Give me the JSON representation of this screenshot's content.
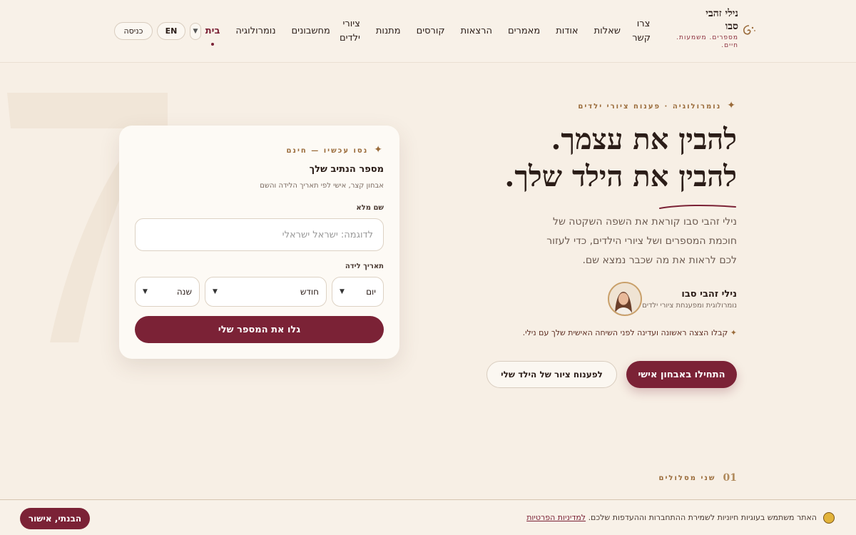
{
  "header": {
    "logo": {
      "title_line1": "נילי זהבי",
      "title_line2": "סבו",
      "tagline": "מספרים. משמעות. חיים."
    },
    "nav": [
      {
        "label": "בית",
        "active": true
      },
      {
        "label": "נומרולוגיה"
      },
      {
        "label": "מחשבונים"
      },
      {
        "label": "ציורי ילדים"
      },
      {
        "label": "מתנות"
      },
      {
        "label": "קורסים"
      },
      {
        "label": "הרצאות"
      },
      {
        "label": "מאמרים"
      },
      {
        "label": "אודות"
      },
      {
        "label": "שאלות"
      },
      {
        "label": "צרו קשר"
      }
    ],
    "lang_label": "EN",
    "login_label": "כניסה",
    "lang_dropdown_icon": "chevron-down-icon"
  },
  "hero": {
    "eyebrow": "נומרולוגיה · פענוח ציורי ילדים",
    "h1_line1": "להבין את עצמך.",
    "h1_line2": "להבין את הילד שלך.",
    "paragraph": "נילי זהבי סבו קוראת את השפה השקטה של חוכמת המספרים ושל ציורי הילדים, כדי לעזור לכם לראות את מה שכבר נמצא שם.",
    "author_name": "נילי זהבי סבו",
    "author_role": "נומרולוגית ומפענחת ציורי ילדים",
    "offer": "קבלו הצצה ראשונה ועדינה לפני השיחה האישית שלך עם נילי.",
    "primary_cta": "התחילו באבחון אישי",
    "secondary_cta": "לפענוח ציור של הילד שלי"
  },
  "form": {
    "eyebrow": "נסו עכשיו — חינם",
    "title": "מספר הנתיב שלך",
    "subtitle": "אבחון קצר, אישי לפי תאריך הלידה והשם",
    "name_label": "שם מלא",
    "name_placeholder": "לדוגמה: ישראל ישראלי",
    "date_label": "תאריך לידה",
    "day": "יום",
    "month": "חודש",
    "year": "שנה",
    "submit": "גלו את המספר שלי"
  },
  "section": {
    "number": "01",
    "label": "שני מסלולים"
  },
  "cookie": {
    "text": "האתר משתמש בעוגיות חיוניות לשמירת ההתחברות וההעדפות שלכם.",
    "link": "למדיניות הפרטיות",
    "button": "הבנתי, אישור"
  },
  "colors": {
    "accent": "#7b2236",
    "gold": "#9a6b3a",
    "background": "#f7efe5"
  }
}
